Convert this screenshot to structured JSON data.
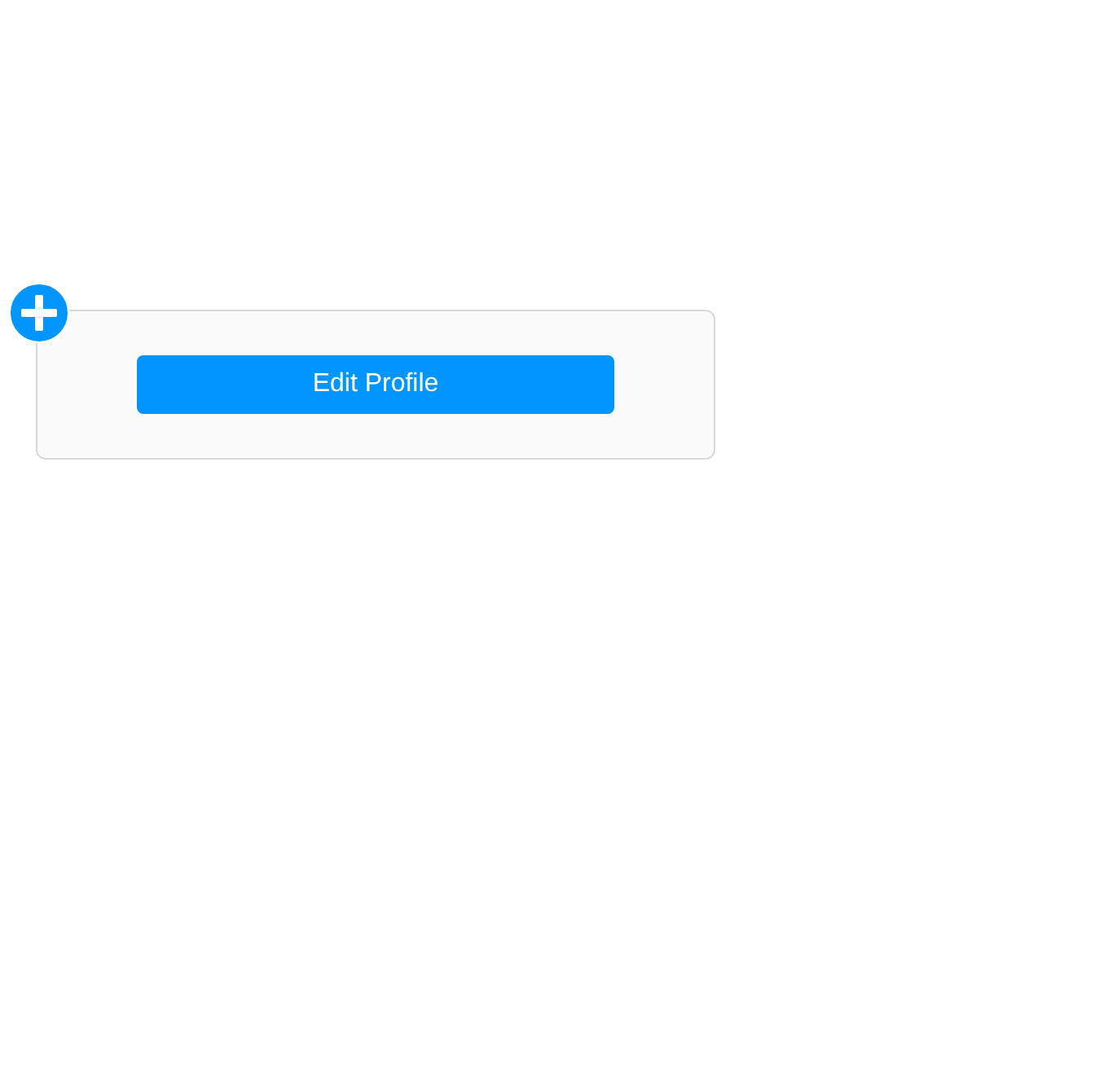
{
  "card": {
    "button": {
      "label": "Edit Profile"
    }
  }
}
